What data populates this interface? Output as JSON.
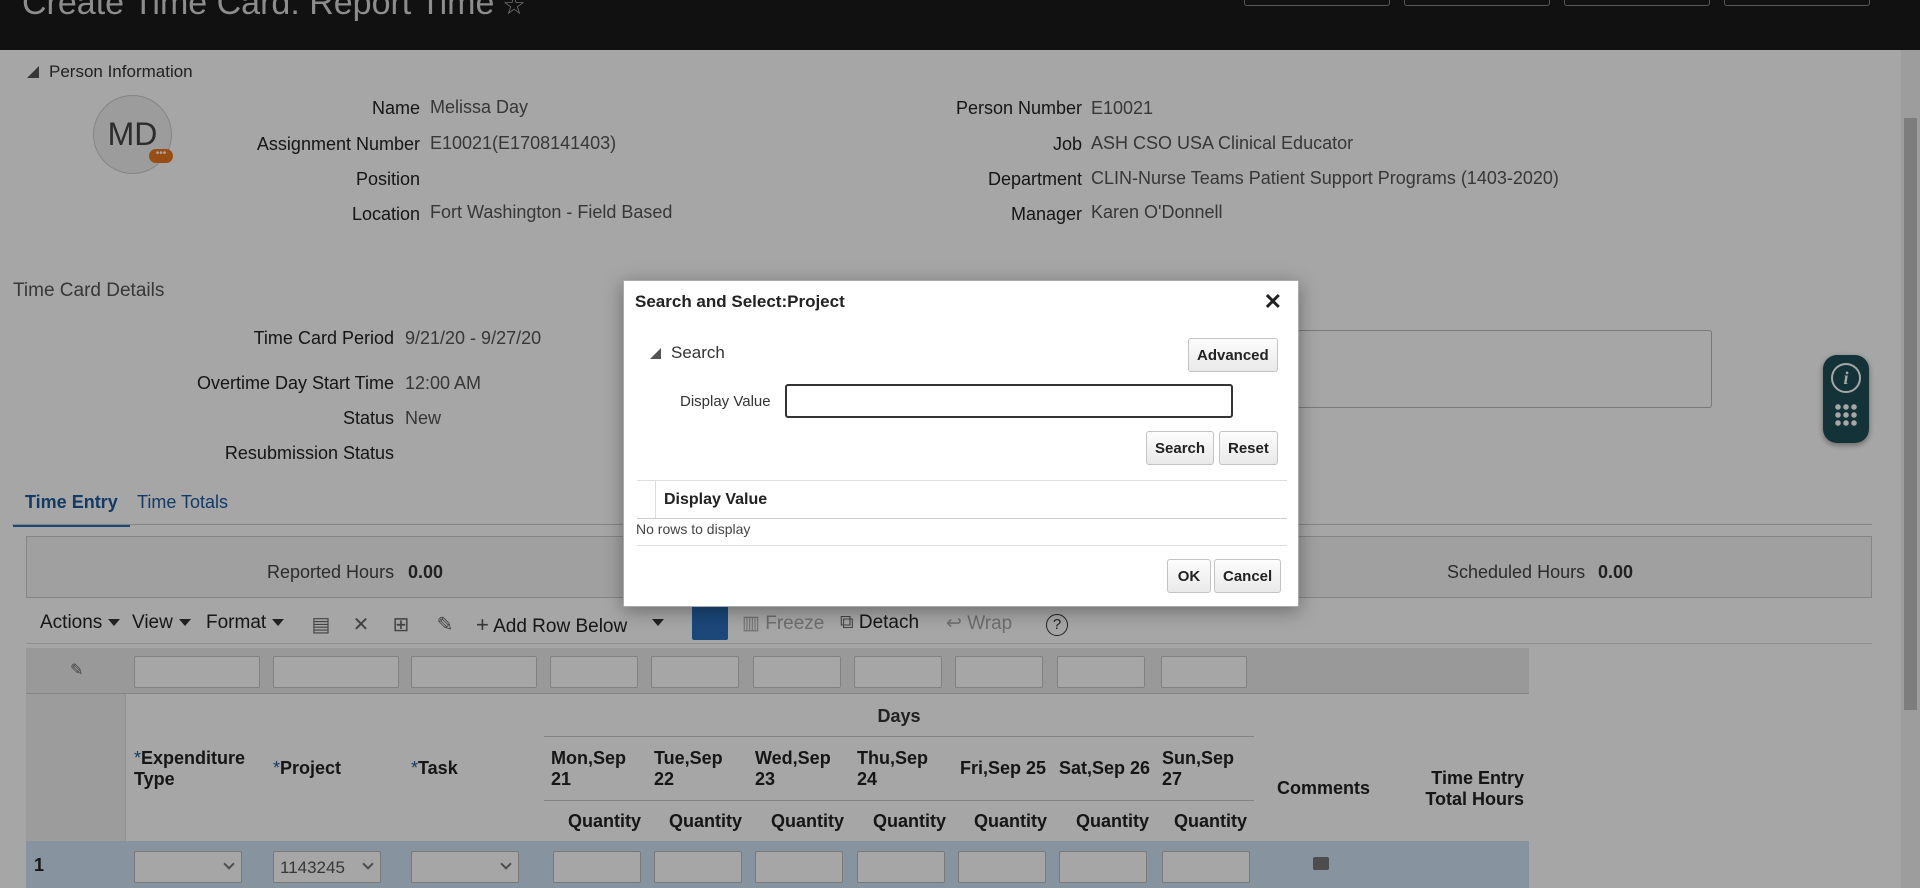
{
  "header": {
    "title": "Create Time Card: Report Time"
  },
  "person": {
    "section_title": "Person Information",
    "initials": "MD",
    "name_label": "Name",
    "name": "Melissa Day",
    "assignment_label": "Assignment Number",
    "assignment": "E10021(E1708141403)",
    "position_label": "Position",
    "position": "",
    "location_label": "Location",
    "location": "Fort Washington - Field Based",
    "person_number_label": "Person Number",
    "person_number": "E10021",
    "job_label": "Job",
    "job": "ASH CSO USA Clinical Educator",
    "department_label": "Department",
    "department": "CLIN-Nurse Teams Patient Support Programs (1403-2020)",
    "manager_label": "Manager",
    "manager": "Karen O'Donnell"
  },
  "timecard": {
    "section_title": "Time Card Details",
    "period_label": "Time Card Period",
    "period": "9/21/20 - 9/27/20",
    "overtime_label": "Overtime Day Start Time",
    "overtime": "12:00 AM",
    "status_label": "Status",
    "status": "New",
    "resubmission_label": "Resubmission Status",
    "resubmission": ""
  },
  "tabs": {
    "time_entry": "Time Entry",
    "time_totals": "Time Totals"
  },
  "hours": {
    "reported_label": "Reported Hours",
    "reported": "0.00",
    "scheduled_label": "Scheduled Hours",
    "scheduled": "0.00"
  },
  "toolbar": {
    "actions": "Actions",
    "view": "View",
    "format": "Format",
    "add_row_below": "Add Row Below",
    "freeze": "Freeze",
    "detach": "Detach",
    "wrap": "Wrap"
  },
  "table": {
    "days_header": "Days",
    "expenditure_type": "Expenditure Type",
    "project": "Project",
    "task": "Task",
    "day_headers": [
      "Mon,Sep 21",
      "Tue,Sep 22",
      "Wed,Sep 23",
      "Thu,Sep 24",
      "Fri,Sep 25",
      "Sat,Sep 26",
      "Sun,Sep 27"
    ],
    "quantity": "Quantity",
    "comments": "Comments",
    "total_hours": "Time Entry Total Hours",
    "row": {
      "number": "1",
      "project_value": "1143245"
    }
  },
  "dialog": {
    "title": "Search and Select:Project",
    "search_section": "Search",
    "advanced_label": "Advanced",
    "display_value_label": "Display Value",
    "display_value": "",
    "search_button": "Search",
    "reset_button": "Reset",
    "column_header": "Display Value",
    "empty_text": "No rows to display",
    "ok_button": "OK",
    "cancel_button": "Cancel"
  },
  "colors": {
    "accent": "#2a6ebb",
    "header_bg": "#1b1b1b",
    "row_selected": "#cfe3f5",
    "help_bg": "#1f4f58"
  }
}
